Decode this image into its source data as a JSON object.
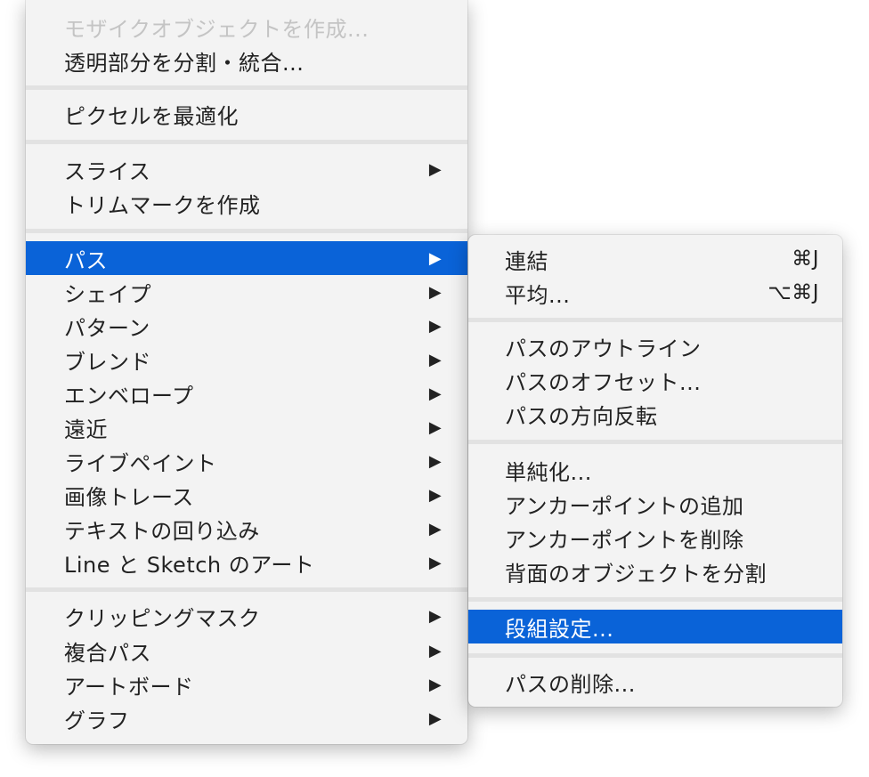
{
  "main_menu": {
    "items": [
      {
        "label": "モザイクオブジェクトを作成...",
        "arrow": ""
      },
      {
        "label": "透明部分を分割・統合...",
        "arrow": ""
      },
      {
        "label": "ピクセルを最適化",
        "arrow": ""
      },
      {
        "label": "スライス",
        "arrow": "▶"
      },
      {
        "label": "トリムマークを作成",
        "arrow": ""
      },
      {
        "label": "パス",
        "arrow": "▶"
      },
      {
        "label": "シェイプ",
        "arrow": "▶"
      },
      {
        "label": "パターン",
        "arrow": "▶"
      },
      {
        "label": "ブレンド",
        "arrow": "▶"
      },
      {
        "label": "エンベロープ",
        "arrow": "▶"
      },
      {
        "label": "遠近",
        "arrow": "▶"
      },
      {
        "label": "ライブペイント",
        "arrow": "▶"
      },
      {
        "label": "画像トレース",
        "arrow": "▶"
      },
      {
        "label": "テキストの回り込み",
        "arrow": "▶"
      },
      {
        "label": "Line と Sketch のアート",
        "arrow": "▶"
      },
      {
        "label": "クリッピングマスク",
        "arrow": "▶"
      },
      {
        "label": "複合パス",
        "arrow": "▶"
      },
      {
        "label": "アートボード",
        "arrow": "▶"
      },
      {
        "label": "グラフ",
        "arrow": "▶"
      }
    ]
  },
  "sub_menu": {
    "items": [
      {
        "label": "連結",
        "shortcut": "⌘J"
      },
      {
        "label": "平均...",
        "shortcut": "⌥⌘J"
      },
      {
        "label": "パスのアウトライン",
        "shortcut": ""
      },
      {
        "label": "パスのオフセット...",
        "shortcut": ""
      },
      {
        "label": "パスの方向反転",
        "shortcut": ""
      },
      {
        "label": "単純化...",
        "shortcut": ""
      },
      {
        "label": "アンカーポイントの追加",
        "shortcut": ""
      },
      {
        "label": "アンカーポイントを削除",
        "shortcut": ""
      },
      {
        "label": "背面のオブジェクトを分割",
        "shortcut": ""
      },
      {
        "label": "段組設定...",
        "shortcut": ""
      },
      {
        "label": "パスの削除...",
        "shortcut": ""
      }
    ]
  },
  "colors": {
    "selection": "#0a63d8",
    "menu_background": "#f3f3f3",
    "text": "#222222"
  }
}
